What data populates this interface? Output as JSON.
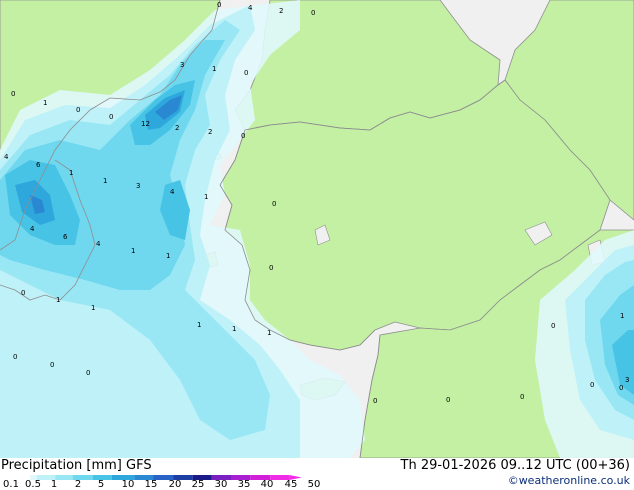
{
  "header": {
    "title_left": "Precipitation [mm] GFS",
    "title_right": "Th 29-01-2026 09..12 UTC (00+36)",
    "credit": "©weatheronline.co.uk"
  },
  "legend": {
    "ticks": [
      "0.1",
      "0.5",
      "1",
      "2",
      "5",
      "10",
      "15",
      "20",
      "25",
      "30",
      "35",
      "40",
      "45",
      "50"
    ],
    "colors": [
      "#e0f8fc",
      "#bff1f8",
      "#99e7f4",
      "#6fd8ee",
      "#47c3e6",
      "#2ea7dd",
      "#2a87d2",
      "#2a63c6",
      "#1d3fa3",
      "#1b1b88",
      "#7a1fc0",
      "#a81fd2",
      "#d21fd8",
      "#f02ce6"
    ]
  },
  "map": {
    "labels": [
      "0",
      "4",
      "2",
      "0",
      "3",
      "1",
      "0",
      "0",
      "1",
      "0",
      "0",
      "12",
      "2",
      "2",
      "0",
      "4",
      "6",
      "1",
      "1",
      "3",
      "4",
      "1",
      "0",
      "4",
      "6",
      "4",
      "1",
      "1",
      "0",
      "0",
      "1",
      "1",
      "1",
      "1",
      "1",
      "0",
      "0",
      "0",
      "0",
      "0",
      "0",
      "0",
      "0",
      "1",
      "0",
      "3"
    ]
  },
  "colors": {
    "sea": "#f0f0f0",
    "land": "#c3f0a3",
    "border": "#8e8e8e"
  }
}
